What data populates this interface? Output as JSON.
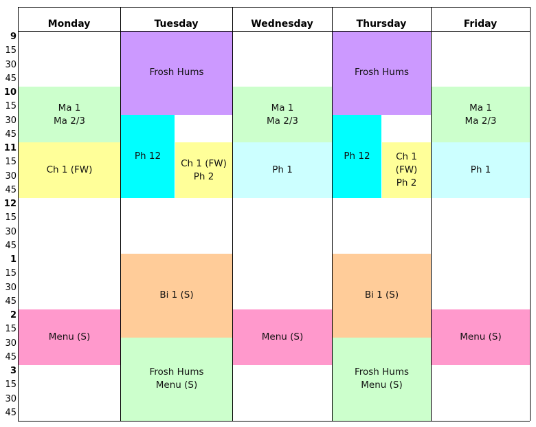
{
  "days": [
    "Monday",
    "Tuesday",
    "Wednesday",
    "Thursday",
    "Friday"
  ],
  "time_labels": [
    "9",
    "15",
    "30",
    "45",
    "10",
    "15",
    "30",
    "45",
    "11",
    "15",
    "30",
    "45",
    "12",
    "15",
    "30",
    "45",
    "1",
    "15",
    "30",
    "45",
    "2",
    "15",
    "30",
    "45",
    "3",
    "15",
    "30",
    "45"
  ],
  "colors": {
    "purple": "#cc99ff",
    "green": "#ccffcc",
    "yellow": "#ffff99",
    "cyan": "#00ffff",
    "lightcyan": "#ccffff",
    "orange": "#ffcc99",
    "pink": "#ff99cc"
  },
  "events": [
    {
      "day": 0,
      "start": "10:00",
      "end": "11:00",
      "lines": [
        "Ma 1",
        "Ma 2/3"
      ],
      "color": "#ccffcc",
      "lane": "full"
    },
    {
      "day": 0,
      "start": "11:00",
      "end": "12:00",
      "lines": [
        "Ch 1 (FW)"
      ],
      "color": "#ffff99",
      "lane": "full"
    },
    {
      "day": 0,
      "start": "2:00",
      "end": "3:00",
      "lines": [
        "Menu (S)"
      ],
      "color": "#ff99cc",
      "lane": "full"
    },
    {
      "day": 1,
      "start": "9:00",
      "end": "10:30",
      "lines": [
        "Frosh Hums"
      ],
      "color": "#cc99ff",
      "lane": "full"
    },
    {
      "day": 1,
      "start": "10:30",
      "end": "12:00",
      "lines": [
        "Ph 12"
      ],
      "color": "#00ffff",
      "lane": "left"
    },
    {
      "day": 1,
      "start": "11:00",
      "end": "12:00",
      "lines": [
        "Ch 1 (FW)",
        "Ph 2"
      ],
      "color": "#ffff99",
      "lane": "right"
    },
    {
      "day": 1,
      "start": "1:00",
      "end": "2:30",
      "lines": [
        "Bi 1 (S)"
      ],
      "color": "#ffcc99",
      "lane": "full"
    },
    {
      "day": 1,
      "start": "2:30",
      "end": "4:00",
      "lines": [
        "Frosh Hums",
        "Menu (S)"
      ],
      "color": "#ccffcc",
      "lane": "full"
    },
    {
      "day": 2,
      "start": "10:00",
      "end": "11:00",
      "lines": [
        "Ma 1",
        "Ma 2/3"
      ],
      "color": "#ccffcc",
      "lane": "full"
    },
    {
      "day": 2,
      "start": "11:00",
      "end": "12:00",
      "lines": [
        "Ph 1"
      ],
      "color": "#ccffff",
      "lane": "full"
    },
    {
      "day": 2,
      "start": "2:00",
      "end": "3:00",
      "lines": [
        "Menu (S)"
      ],
      "color": "#ff99cc",
      "lane": "full"
    },
    {
      "day": 3,
      "start": "9:00",
      "end": "10:30",
      "lines": [
        "Frosh Hums"
      ],
      "color": "#cc99ff",
      "lane": "full"
    },
    {
      "day": 3,
      "start": "10:30",
      "end": "12:00",
      "lines": [
        "Ph 12"
      ],
      "color": "#00ffff",
      "lane": "left"
    },
    {
      "day": 3,
      "start": "11:00",
      "end": "12:00",
      "lines": [
        "Ch 1",
        "(FW)",
        "Ph 2"
      ],
      "color": "#ffff99",
      "lane": "right"
    },
    {
      "day": 3,
      "start": "1:00",
      "end": "2:30",
      "lines": [
        "Bi 1 (S)"
      ],
      "color": "#ffcc99",
      "lane": "full"
    },
    {
      "day": 3,
      "start": "2:30",
      "end": "4:00",
      "lines": [
        "Frosh Hums",
        "Menu (S)"
      ],
      "color": "#ccffcc",
      "lane": "full"
    },
    {
      "day": 4,
      "start": "10:00",
      "end": "11:00",
      "lines": [
        "Ma 1",
        "Ma 2/3"
      ],
      "color": "#ccffcc",
      "lane": "full"
    },
    {
      "day": 4,
      "start": "11:00",
      "end": "12:00",
      "lines": [
        "Ph 1"
      ],
      "color": "#ccffff",
      "lane": "full"
    },
    {
      "day": 4,
      "start": "2:00",
      "end": "3:00",
      "lines": [
        "Menu (S)"
      ],
      "color": "#ff99cc",
      "lane": "full"
    }
  ]
}
